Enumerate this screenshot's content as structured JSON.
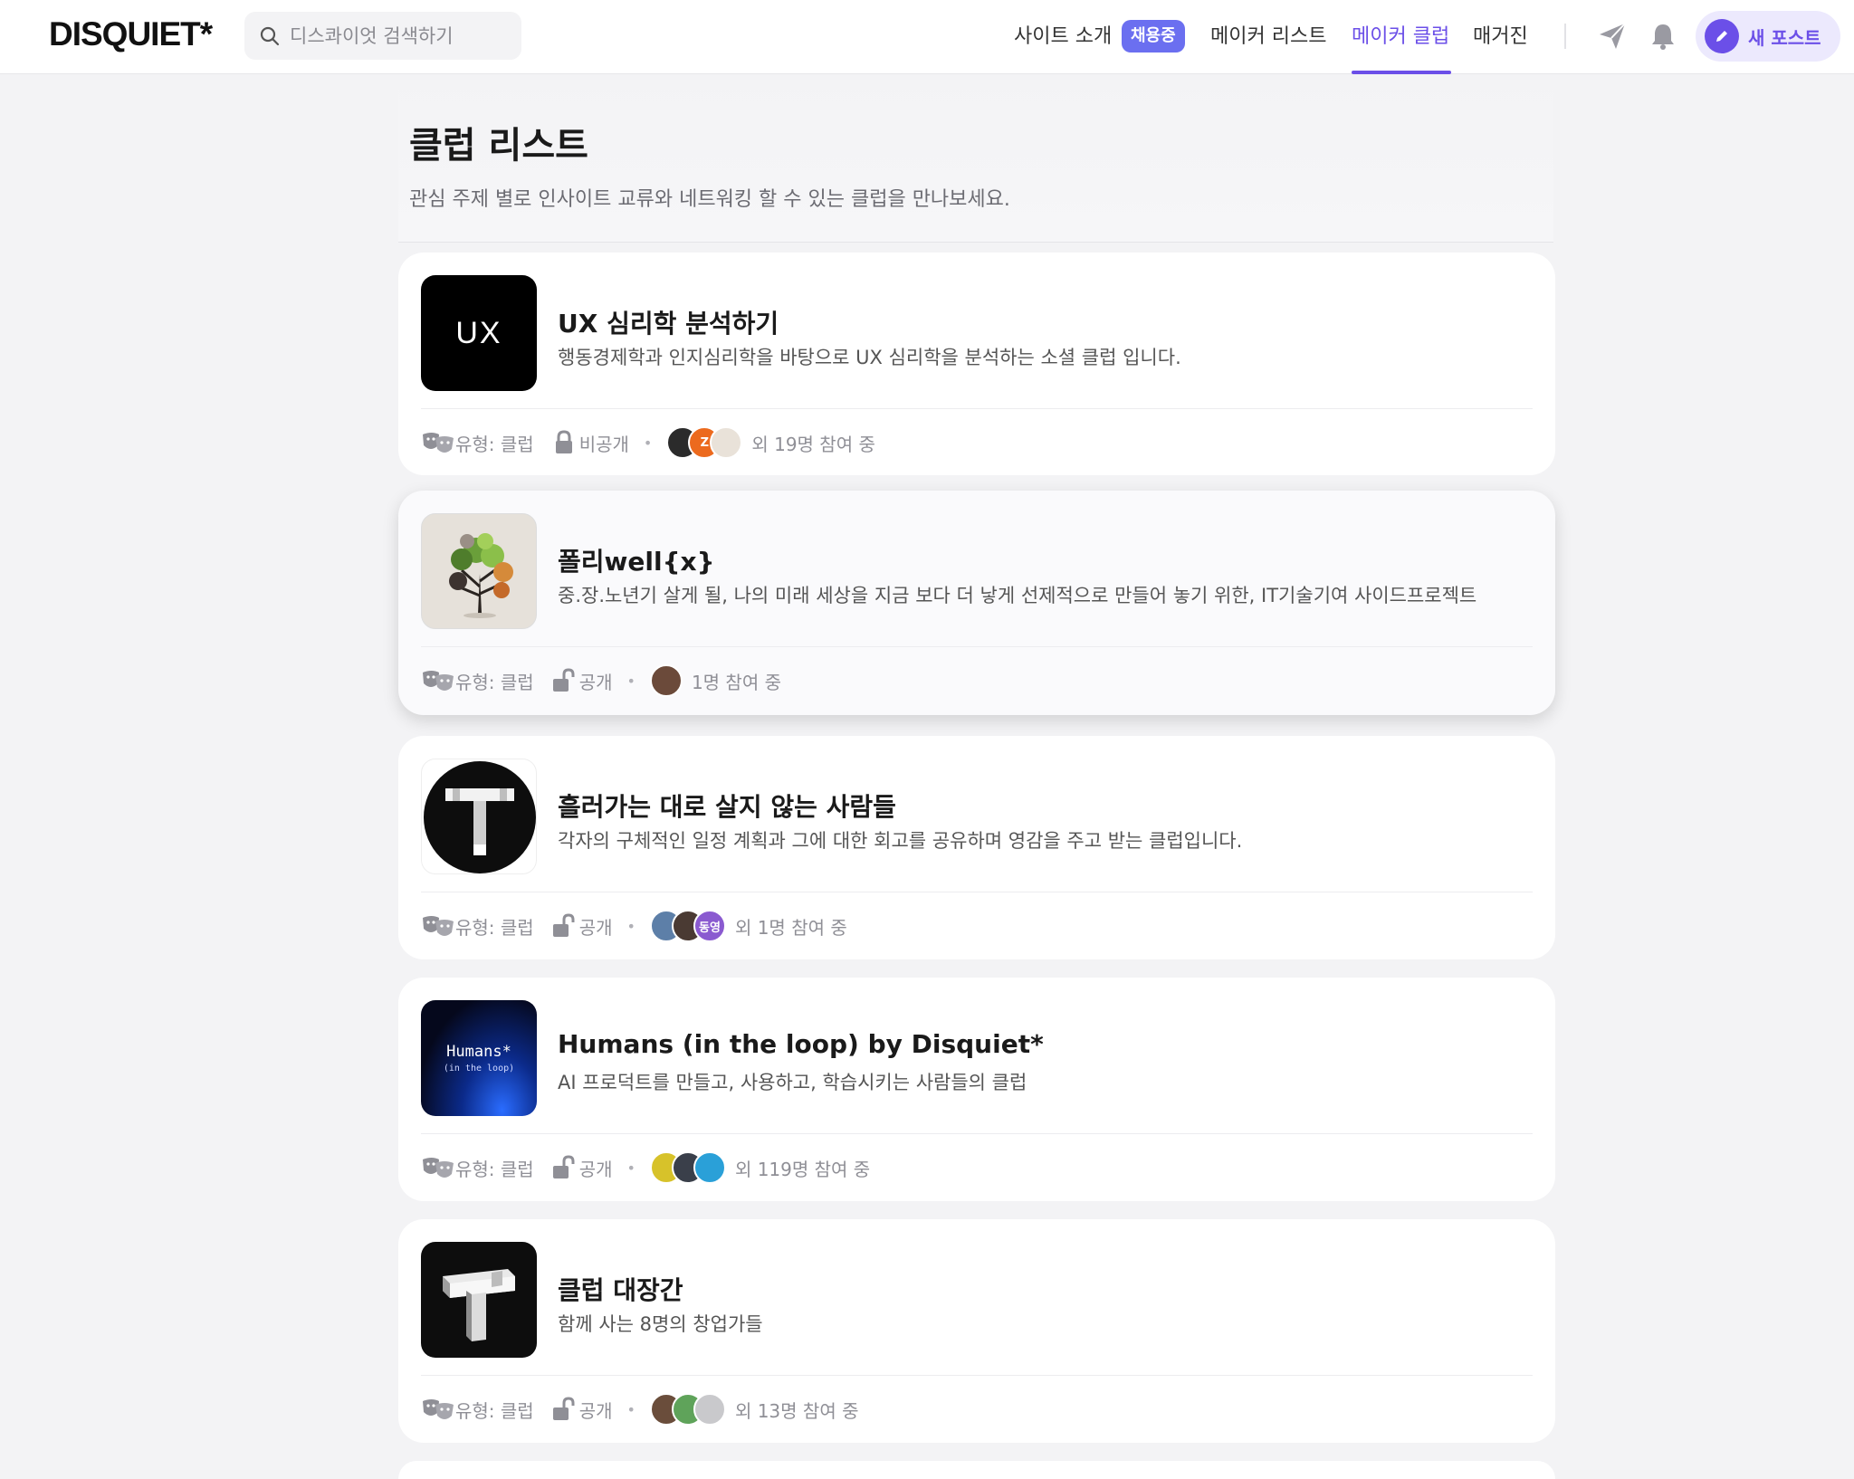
{
  "header": {
    "logo": "DISQUIET*",
    "search_placeholder": "디스콰이엇 검색하기",
    "nav": [
      {
        "label": "사이트 소개"
      },
      {
        "label": "메이커 리스트"
      },
      {
        "label": "메이커 클럽"
      },
      {
        "label": "매거진"
      }
    ],
    "hiring_badge": "채용중",
    "new_post_label": "새 포스트",
    "accent_color": "#6b4fe8"
  },
  "page": {
    "title": "클럽 리스트",
    "subtitle": "관심 주제 별로 인사이트 교류와 네트워킹 할 수 있는 클럽을 만나보세요."
  },
  "clubs": [
    {
      "title": "UX 심리학 분석하기",
      "description": "행동경제학과 인지심리학을 바탕으로 UX 심리학을 분석하는 소셜 클럽 입니다.",
      "thumb_text": "UX",
      "type_label": "유형: 클럽",
      "visibility": "비공개",
      "participants": "외 19명 참여 중"
    },
    {
      "title": "폴리well{x}",
      "description": "중.장.노년기 살게 될, 나의 미래 세상을 지금 보다 더 낳게 선제적으로 만들어 놓기 위한, IT기술기여 사이드프로젝트",
      "type_label": "유형: 클럽",
      "visibility": "공개",
      "participants": "1명 참여 중"
    },
    {
      "title": "흘러가는 대로 살지 않는 사람들",
      "description": "각자의 구체적인 일정 계획과 그에 대한 회고를 공유하며 영감을 주고 받는 클럽입니다.",
      "type_label": "유형: 클럽",
      "visibility": "공개",
      "participants": "외 1명 참여 중",
      "avatar_text": "동영"
    },
    {
      "title": "Humans (in the loop) by Disquiet*",
      "description": "AI 프로덕트를 만들고, 사용하고, 학습시키는 사람들의 클럽",
      "thumb_line1": "Humans*",
      "thumb_line2": "(in the loop)",
      "type_label": "유형: 클럽",
      "visibility": "공개",
      "participants": "외 119명 참여 중"
    },
    {
      "title": "클럽 대장간",
      "description": "함께 사는 8명의 창업가들",
      "type_label": "유형: 클럽",
      "visibility": "공개",
      "participants": "외 13명 참여 중"
    }
  ]
}
